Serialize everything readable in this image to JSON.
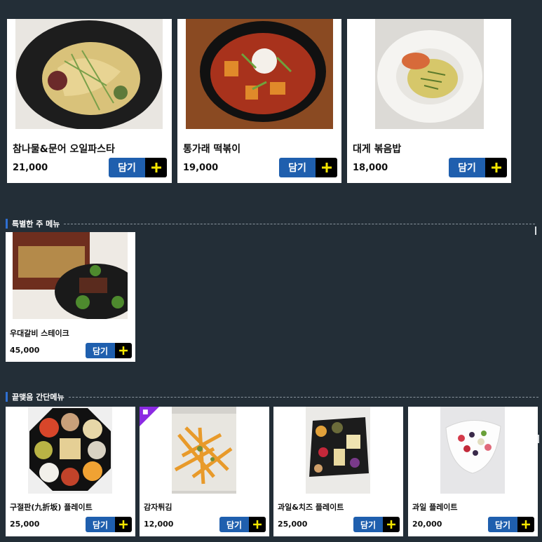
{
  "top_items": [
    {
      "name": "참나물&문어 오일파스타",
      "price": "21,000",
      "cart_label": "담기"
    },
    {
      "name": "통가래 떡볶이",
      "price": "19,000",
      "cart_label": "담기"
    },
    {
      "name": "대게 볶음밥",
      "price": "18,000",
      "cart_label": "담기"
    }
  ],
  "special_section": {
    "title": "특별한 주 메뉴",
    "items": [
      {
        "name": "우대갈비 스테이크",
        "price": "45,000",
        "cart_label": "담기"
      }
    ]
  },
  "snack_section": {
    "title": "끝맺음 간단메뉴",
    "items": [
      {
        "name": "구절판(九折坂) 플레이트",
        "price": "25,000",
        "cart_label": "담기"
      },
      {
        "name": "감자튀김",
        "price": "12,000",
        "cart_label": "담기",
        "badge": true
      },
      {
        "name": "과일&치즈 플레이트",
        "price": "25,000",
        "cart_label": "담기"
      },
      {
        "name": "과일 플레이트",
        "price": "20,000",
        "cart_label": "담기"
      }
    ]
  },
  "icons": {
    "plus": "plus-icon",
    "badge": "new-badge-icon"
  },
  "colors": {
    "background": "#232e37",
    "button": "#1f5fae",
    "plus_bg": "#000000",
    "plus_fg": "#f5e600",
    "badge": "#8b2be2"
  }
}
